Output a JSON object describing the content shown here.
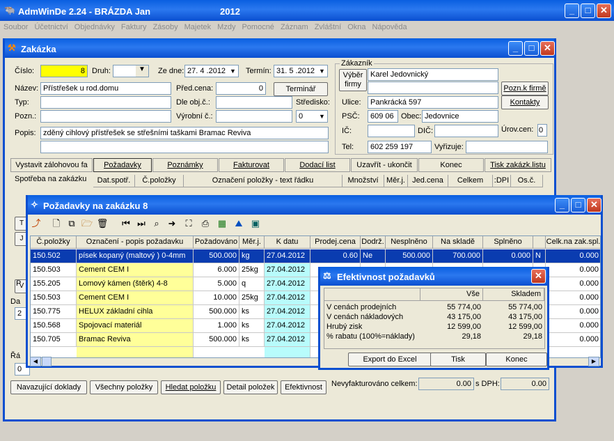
{
  "app": {
    "title": "AdmWinDe 2.24 - BRÁZDA Jan",
    "year": "2012"
  },
  "menu": [
    "Soubor",
    "Účetnictví",
    "Objednávky",
    "Faktury",
    "Zásoby",
    "Majetek",
    "Mzdy",
    "Pomocné",
    "Záznam",
    "Zvláštní",
    "Okna",
    "Nápověda"
  ],
  "zakazka": {
    "title": "Zakázka",
    "cislo_label": "Číslo:",
    "cislo": "8",
    "druh_label": "Druh:",
    "zedne_label": "Ze dne:",
    "zedne": "27. 4 .2012",
    "termin_label": "Termín:",
    "termin": "31. 5 .2012",
    "nazev_label": "Název:",
    "nazev": "Přístřešek u rod.domu",
    "typ_label": "Typ:",
    "pozn_label": "Pozn.:",
    "predcena_label": "Před.cena:",
    "predcena": "0",
    "terminar": "Terminář",
    "dleobj_label": "Dle obj.č.:",
    "stredisko_label": "Středisko:",
    "stredisko": "0",
    "vyrobni_label": "Výrobní č.:",
    "popis_label": "Popis:",
    "popis": "zděný cihlový přístřešek se střešními taškami Bramac Reviva",
    "zakaznik_label": "Zákazník",
    "vyber_firmy": "Výběr firmy",
    "firma": "Karel Jedovnický",
    "poznk_firme": "Pozn.k firmě",
    "ulice_label": "Ulice:",
    "ulice": "Pankrácká 597",
    "kontakty": "Kontakty",
    "psc_label": "PSČ:",
    "psc": "609 06",
    "obec_label": "Obec:",
    "obec": "Jedovnice",
    "ic_label": "IČ:",
    "dic_label": "DIČ:",
    "urovcen_label": "Úrov.cen:",
    "urovcen": "0",
    "tel_label": "Tel:",
    "tel": "602 259 197",
    "vyrizuje_label": "Vyřizuje:",
    "tabs": [
      "Vystavit zálohovou fa",
      "Požadavky",
      "Poznámky",
      "Fakturovat",
      "Dodací list",
      "Uzavřít - ukončit",
      "Konec",
      "Tisk zakázk.listu"
    ],
    "spotreba_label": "Spotřeba na zakázku",
    "spotreba_cols": [
      "Dat.spotř.",
      "Č.položky",
      "Označení položky - text řádku",
      "Množství",
      "Měr.j.",
      "Jed.cena",
      "Celkem",
      ":DPI",
      "Os.č."
    ],
    "left_stub": [
      "T",
      "J",
      "V",
      "P",
      "Da",
      "2",
      "Řá",
      "0"
    ],
    "bottom_buttons": [
      "Navazující doklady",
      "Všechny položky",
      "Hledat položku",
      "Detail položek",
      "Efektivnost"
    ],
    "nevyfakturovano_label": "Nevyfakturováno celkem:",
    "nevyfakturovano": "0.00",
    "sdph_label": "s DPH:",
    "sdph": "0.00"
  },
  "pozadavky": {
    "title": "Požadavky na zakázku 8",
    "columns": [
      "Č.položky",
      "Označení - popis požadavku",
      "Požadováno",
      "Měr.j.",
      "K datu",
      "Prodej.cena",
      "Dodrž.",
      "Nesplněno",
      "Na skladě",
      "Splněno",
      "",
      "Celk.na zak.spl."
    ],
    "rows": [
      [
        "150.502",
        "písek kopaný (maltový ) 0-4mm",
        "500.000",
        "kg",
        "27.04.2012",
        "0.60",
        "Ne",
        "500.000",
        "700.000",
        "0.000",
        "N",
        "0.000"
      ],
      [
        "150.503",
        "Cement CEM I",
        "6.000",
        "25kg",
        "27.04.2012",
        "",
        "",
        "",
        "",
        "",
        "",
        "0.000"
      ],
      [
        "155.205",
        "Lomový kámen (štěrk) 4-8",
        "5.000",
        "q",
        "27.04.2012",
        "",
        "",
        "",
        "",
        "",
        "",
        "0.000"
      ],
      [
        "150.503",
        "Cement CEM I",
        "10.000",
        "25kg",
        "27.04.2012",
        "",
        "",
        "",
        "",
        "",
        "",
        "0.000"
      ],
      [
        "150.775",
        "HELUX základní cihla",
        "500.000",
        "ks",
        "27.04.2012",
        "",
        "",
        "",
        "",
        "",
        "",
        "0.000"
      ],
      [
        "150.568",
        "Spojovací materiál",
        "1.000",
        "ks",
        "27.04.2012",
        "",
        "",
        "",
        "",
        "",
        "",
        "0.000"
      ],
      [
        "150.705",
        "Bramac Reviva",
        "500.000",
        "ks",
        "27.04.2012",
        "",
        "",
        "",
        "",
        "",
        "",
        "0.000"
      ]
    ]
  },
  "efektivnost": {
    "title": "Efektivnost požadavků",
    "cols": [
      "",
      "Vše",
      "Skladem"
    ],
    "rows": [
      [
        "V cenách prodejních",
        "55 774,00",
        "55 774,00"
      ],
      [
        "V cenách nákladových",
        "43 175,00",
        "43 175,00"
      ],
      [
        "Hrubý zisk",
        "12 599,00",
        "12 599,00"
      ],
      [
        "% rabatu (100%=náklady)",
        "29,18",
        "29,18"
      ]
    ],
    "buttons": [
      "Export do Excel",
      "Tisk",
      "Konec"
    ]
  },
  "colors": {
    "xp_title": "#0a5fe0",
    "highlight_yellow": "#ffff00",
    "row_select": "#0a3cb0",
    "pale_yellow": "#ffff99",
    "pale_cyan": "#b8fcfc"
  }
}
